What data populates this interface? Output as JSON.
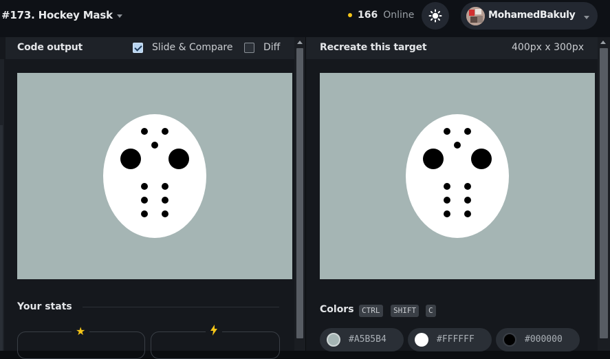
{
  "header": {
    "challenge_title": "#173. Hockey Mask",
    "online_count": "166",
    "online_label": "Online",
    "user_name": "MohamedBakuly"
  },
  "left_panel": {
    "title": "Code output",
    "slide_compare_label": "Slide & Compare",
    "slide_compare_checked": true,
    "diff_label": "Diff",
    "diff_checked": false
  },
  "right_panel": {
    "title": "Recreate this target",
    "dimensions": "400px x 300px"
  },
  "stats": {
    "title": "Your stats",
    "icons": [
      "star-icon",
      "bolt-icon"
    ]
  },
  "colors": {
    "title": "Colors",
    "shortcut": [
      "CTRL",
      "SHIFT",
      "C"
    ],
    "swatches": [
      {
        "hex": "#A5B5B4"
      },
      {
        "hex": "#FFFFFF"
      },
      {
        "hex": "#000000"
      }
    ]
  },
  "palette": {
    "background": "#A5B5B4",
    "mask": "#FFFFFF",
    "holes": "#000000",
    "accent": "#F5C518"
  }
}
